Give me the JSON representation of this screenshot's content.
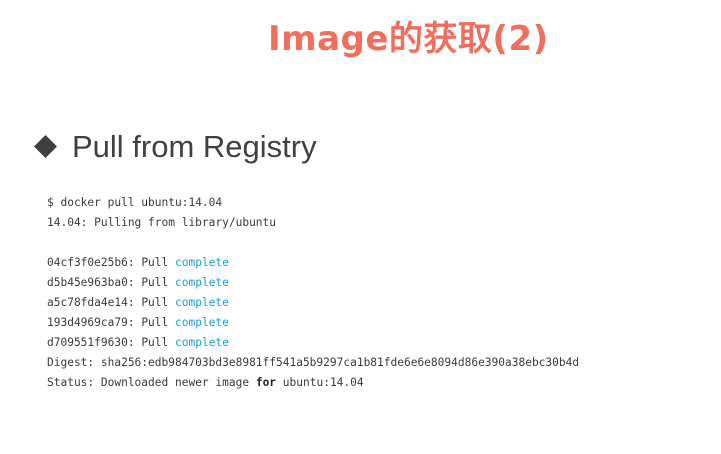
{
  "slide": {
    "title": "Image的获取(2)",
    "accent_color": "#ef6f5c"
  },
  "section": {
    "bullet_icon": "diamond-icon",
    "heading": "Pull from Registry"
  },
  "terminal": {
    "command": "$ docker pull ubuntu:14.04",
    "pulling_line": "14.04: Pulling from library/ubuntu",
    "layers": [
      {
        "id": "04cf3f0e25b6:",
        "action": "Pull",
        "status": "complete"
      },
      {
        "id": "d5b45e963ba0:",
        "action": "Pull",
        "status": "complete"
      },
      {
        "id": "a5c78fda4e14:",
        "action": "Pull",
        "status": "complete"
      },
      {
        "id": "193d4969ca79:",
        "action": "Pull",
        "status": "complete"
      },
      {
        "id": "d709551f9630:",
        "action": "Pull",
        "status": "complete"
      }
    ],
    "digest": "Digest: sha256:edb984703bd3e8981ff541a5b9297ca1b81fde6e6e8094d86e390a38ebc30b4d",
    "status_prefix": "Status: Downloaded newer image",
    "status_keyword": "for",
    "status_suffix": "ubuntu:14.04",
    "status_color": "#1a9fd6"
  }
}
